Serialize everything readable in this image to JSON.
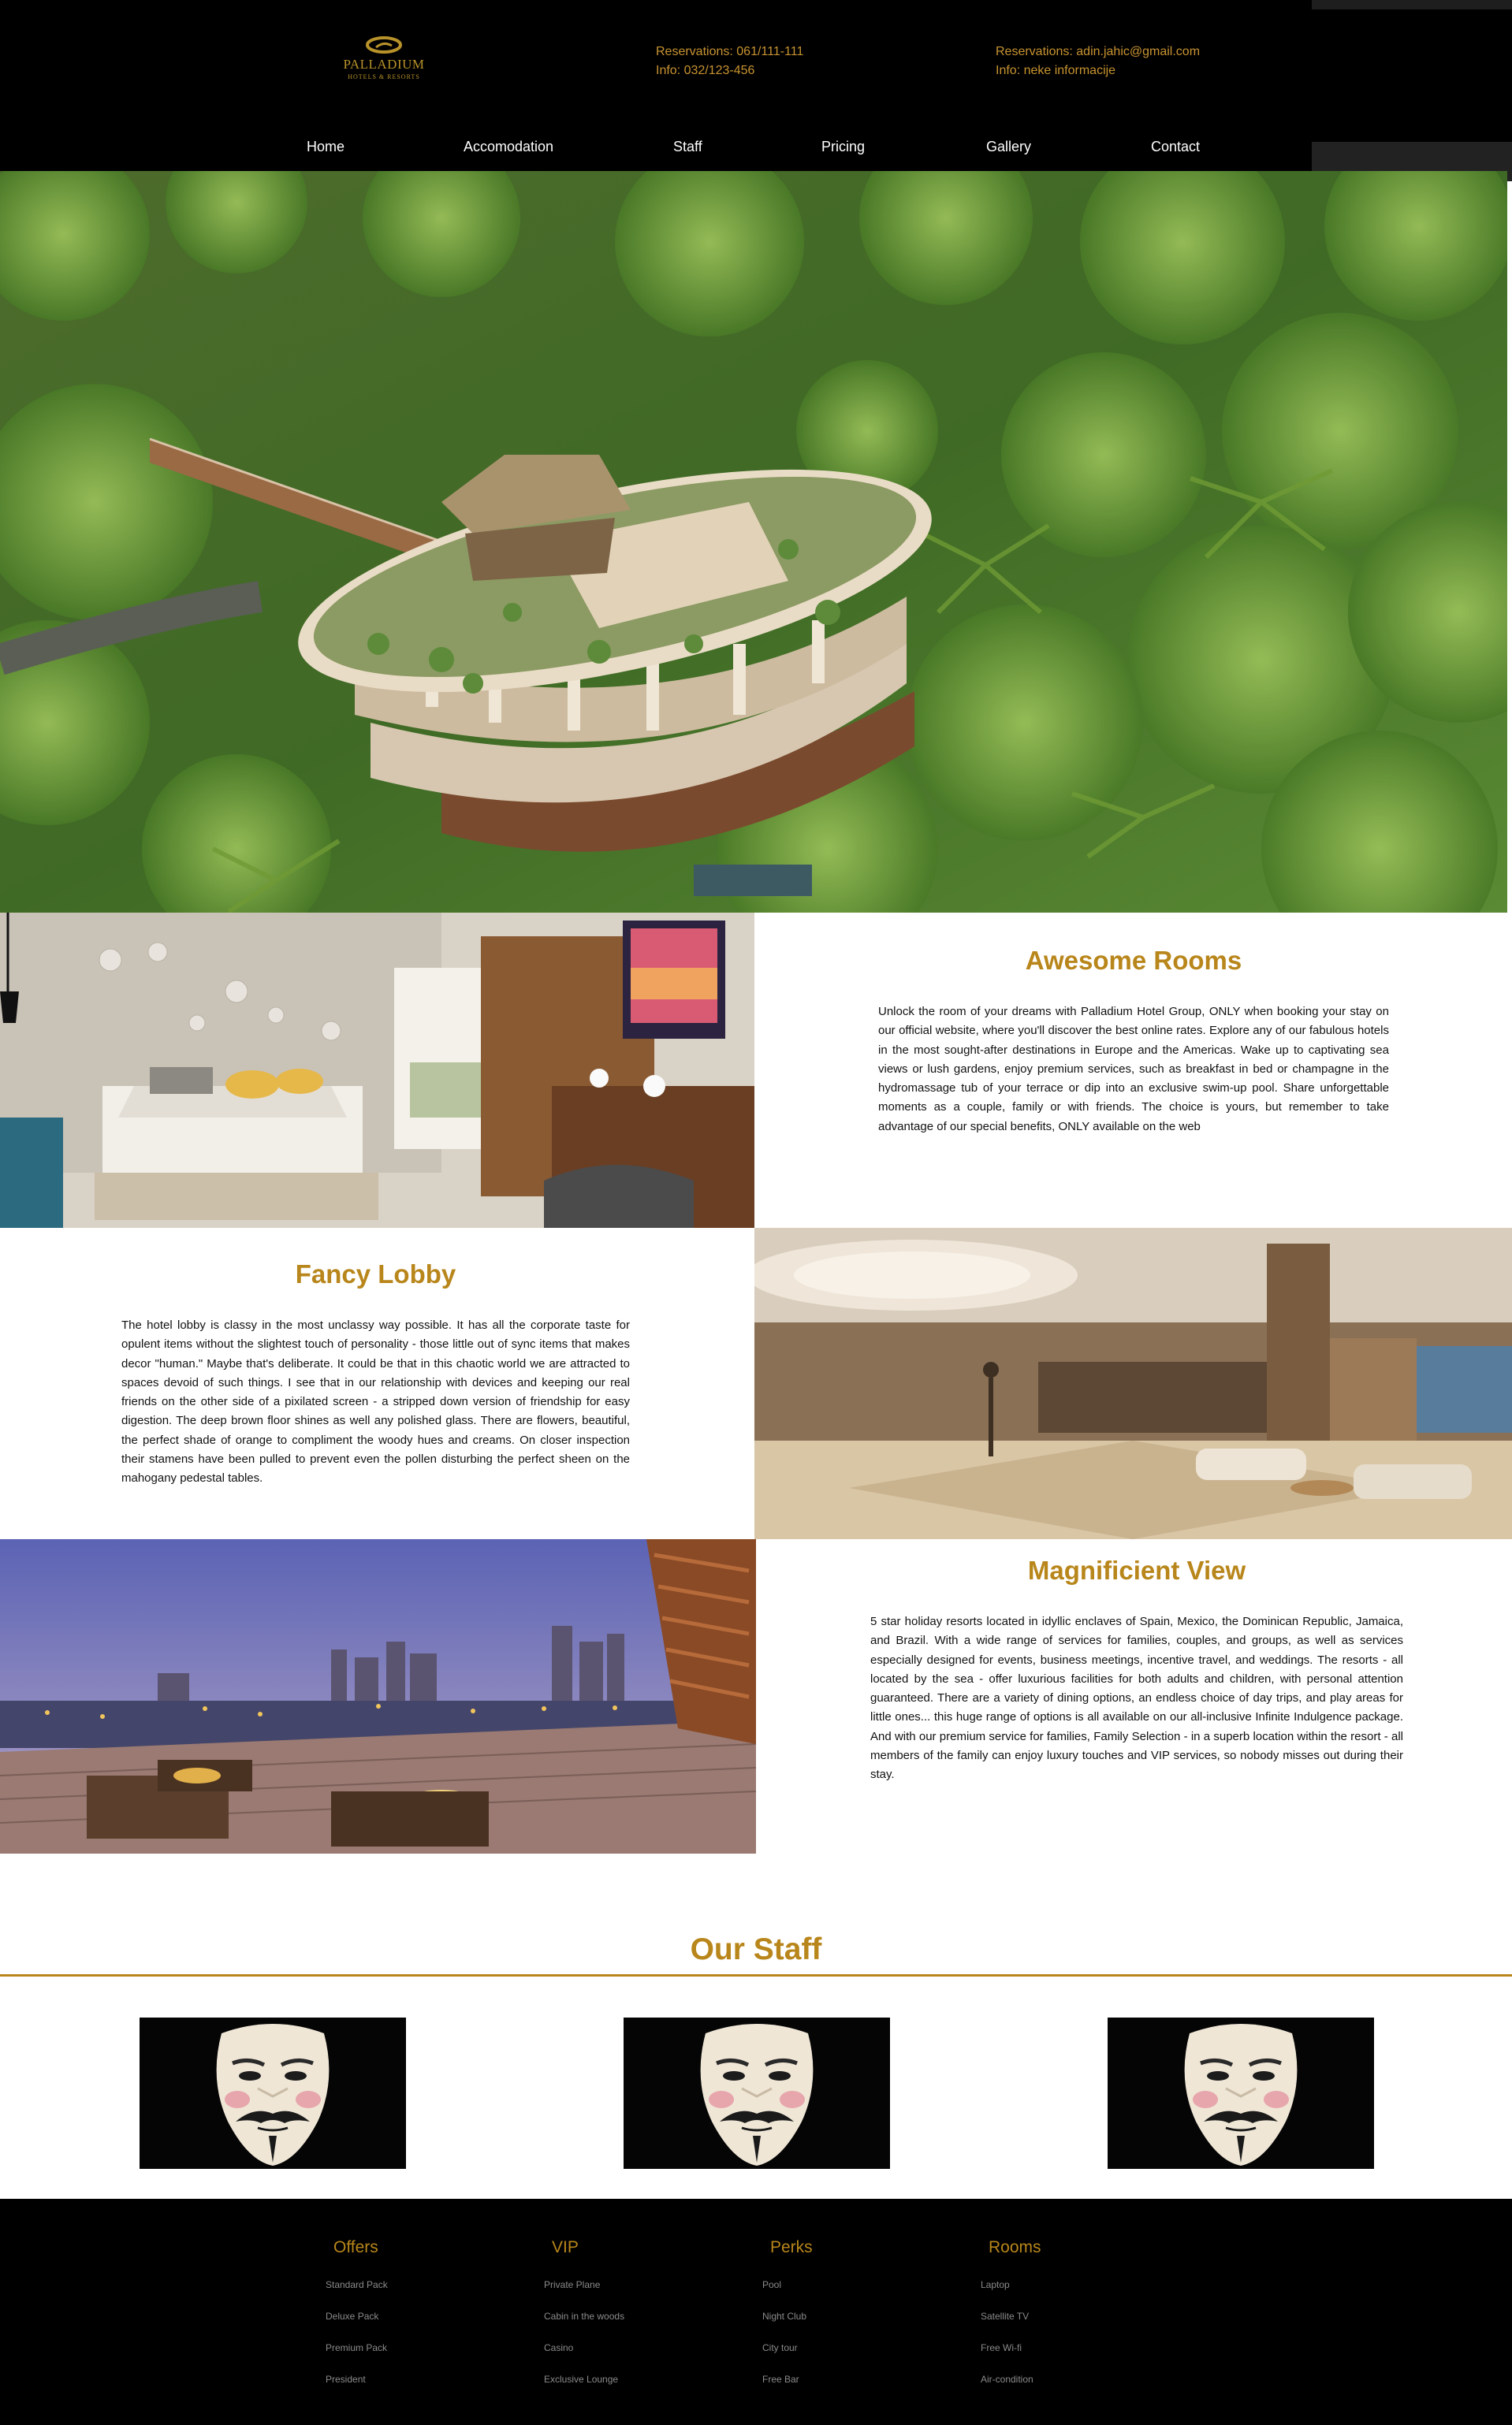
{
  "brand": {
    "name": "PALLADIUM",
    "tagline": "HOTELS & RESORTS",
    "accent_color": "#b8861b"
  },
  "header": {
    "contact_left": [
      "Reservations: 061/111-111",
      "Info: 032/123-456"
    ],
    "contact_right": [
      "Reservations: adin.jahic@gmail.com",
      "Info: neke informacije"
    ]
  },
  "nav": [
    "Home",
    "Accomodation",
    "Staff",
    "Pricing",
    "Gallery",
    "Contact"
  ],
  "features": [
    {
      "title": "Awesome Rooms",
      "body": "Unlock the room of your dreams with Palladium Hotel Group, ONLY when booking your stay on our official website, where you'll discover the best online rates. Explore any of our fabulous hotels in the most sought-after destinations in Europe and the Americas. Wake up to captivating sea views or lush gardens, enjoy premium services, such as breakfast in bed or champagne in the hydromassage tub of your terrace or dip into an exclusive swim-up pool. Share unforgettable moments as a couple, family or with friends. The choice is yours, but remember to take advantage of our special benefits, ONLY available on the web"
    },
    {
      "title": "Fancy Lobby",
      "body": "The hotel lobby is classy in the most unclassy way possible. It has all the corporate taste for opulent items without the slightest touch of personality - those little out of sync items that makes decor \"human.\" Maybe that's deliberate. It could be that in this chaotic world we are attracted to spaces devoid of such things. I see that in our relationship with devices and keeping our real friends on the other side of a pixilated screen - a stripped down version of friendship for easy digestion. The deep brown floor shines as well any polished glass. There are flowers, beautiful, the perfect shade of orange to compliment the woody hues and creams. On closer inspection their stamens have been pulled to prevent even the pollen disturbing the perfect sheen on the mahogany pedestal tables."
    },
    {
      "title": "Magnificient View",
      "body": "5 star holiday resorts located in idyllic enclaves of Spain, Mexico, the Dominican Republic, Jamaica, and Brazil. With a wide range of services for families, couples, and groups, as well as services especially designed for events, business meetings, incentive travel, and weddings. The resorts - all located by the sea - offer luxurious facilities for both adults and children, with personal attention guaranteed. There are a variety of dining options, an endless choice of day trips, and play areas for little ones... this huge range of options is all available on our all-inclusive Infinite Indulgence package. And with our premium service for families, Family Selection - in a superb location within the resort - all members of the family can enjoy luxury touches and VIP services, so nobody misses out during their stay."
    }
  ],
  "staff": {
    "title": "Our Staff",
    "members": [
      "mask-portrait",
      "mask-portrait",
      "mask-portrait"
    ]
  },
  "footer": {
    "columns": [
      {
        "heading": "Offers",
        "items": [
          "Standard Pack",
          "Deluxe Pack",
          "Premium Pack",
          "President"
        ]
      },
      {
        "heading": "VIP",
        "items": [
          "Private Plane",
          "Cabin in the woods",
          "Casino",
          "Exclusive Lounge"
        ]
      },
      {
        "heading": "Perks",
        "items": [
          "Pool",
          "Night Club",
          "City tour",
          "Free Bar"
        ]
      },
      {
        "heading": "Rooms",
        "items": [
          "Laptop",
          "Satellite TV",
          "Free Wi-fi",
          "Air-condition"
        ]
      }
    ]
  }
}
